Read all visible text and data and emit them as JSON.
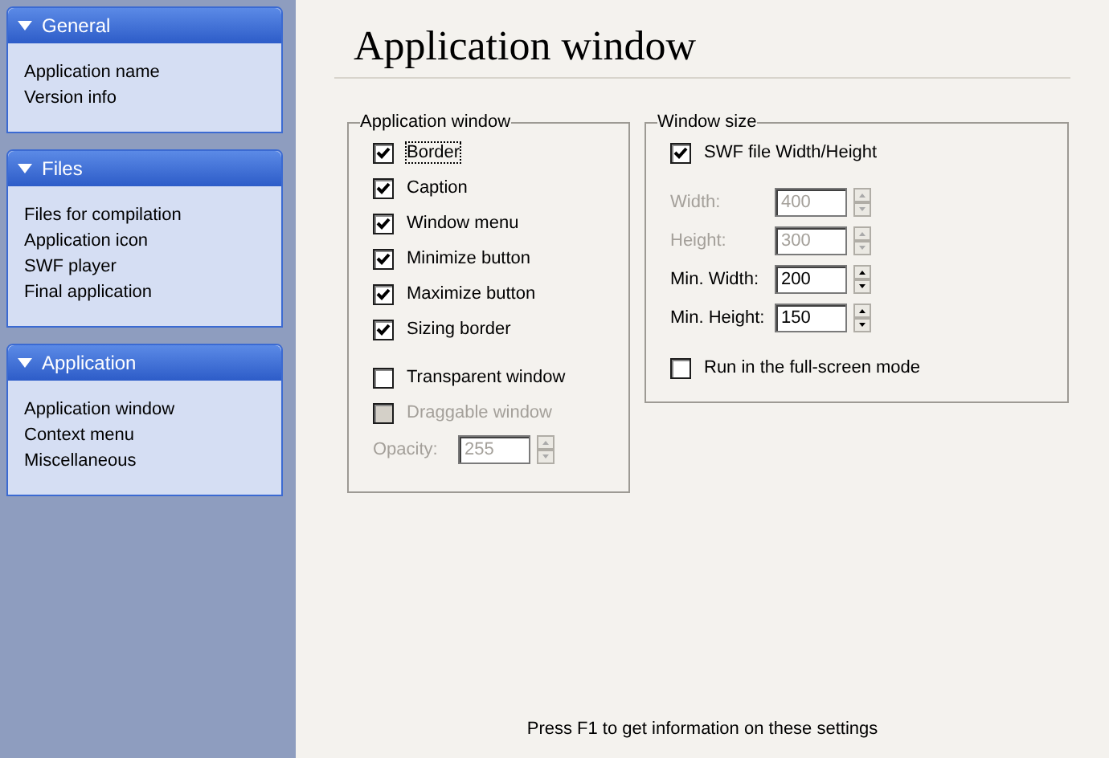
{
  "sidebar": {
    "sections": [
      {
        "title": "General",
        "expanded": true,
        "items": [
          "Application name",
          "Version info"
        ]
      },
      {
        "title": "Files",
        "expanded": true,
        "items": [
          "Files for compilation",
          "Application icon",
          "SWF player",
          "Final application"
        ]
      },
      {
        "title": "Application",
        "expanded": true,
        "items": [
          "Application window",
          "Context menu",
          "Miscellaneous"
        ]
      }
    ]
  },
  "page_title": "Application window",
  "groups": [
    {
      "title": "Application window",
      "blocks": [
        [
          {
            "kind": "checkbox",
            "label": "Border",
            "checked": true,
            "disabled": false,
            "focused": true
          },
          {
            "kind": "checkbox",
            "label": "Caption",
            "checked": true,
            "disabled": false,
            "focused": false
          },
          {
            "kind": "checkbox",
            "label": "Window menu",
            "checked": true,
            "disabled": false,
            "focused": false
          },
          {
            "kind": "checkbox",
            "label": "Minimize button",
            "checked": true,
            "disabled": false,
            "focused": false
          },
          {
            "kind": "checkbox",
            "label": "Maximize button",
            "checked": true,
            "disabled": false,
            "focused": false
          },
          {
            "kind": "checkbox",
            "label": "Sizing border",
            "checked": true,
            "disabled": false,
            "focused": false
          }
        ],
        [
          {
            "kind": "checkbox",
            "label": "Transparent window",
            "checked": false,
            "disabled": false,
            "focused": false
          },
          {
            "kind": "checkbox",
            "label": "Draggable window",
            "checked": false,
            "disabled": true,
            "focused": false
          },
          {
            "kind": "spinner",
            "label": "Opacity:",
            "value": "255",
            "disabled": true
          }
        ]
      ]
    },
    {
      "title": "Window size",
      "blocks": [
        [
          {
            "kind": "checkbox",
            "label": "SWF file Width/Height",
            "checked": true,
            "disabled": false,
            "focused": false
          }
        ],
        [
          {
            "kind": "spinner",
            "label": "Width:",
            "value": "400",
            "disabled": true
          },
          {
            "kind": "spinner",
            "label": "Height:",
            "value": "300",
            "disabled": true
          },
          {
            "kind": "spinner",
            "label": "Min. Width:",
            "value": "200",
            "disabled": false
          },
          {
            "kind": "spinner",
            "label": "Min. Height:",
            "value": "150",
            "disabled": false
          }
        ],
        [
          {
            "kind": "checkbox",
            "label": "Run in the full-screen mode",
            "checked": false,
            "disabled": false,
            "focused": false
          }
        ]
      ]
    }
  ],
  "footer": "Press F1 to get information on these settings"
}
